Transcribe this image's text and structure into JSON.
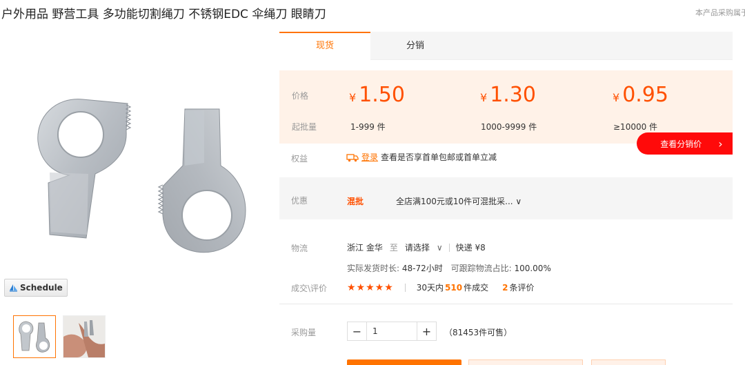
{
  "product": {
    "title": "户外用品 野营工具 多功能切割绳刀 不锈钢EDC 伞绳刀 眼睛刀",
    "top_note": "本产品采购属于",
    "main_image": "stainless steel eye-shaped rope cutter tools",
    "thumb_1": "two rope cutter tools",
    "thumb_2": "rope cutter held in fingers",
    "schedule_label": "Schedule"
  },
  "tabs": [
    {
      "label": "现货"
    },
    {
      "label": "分销"
    }
  ],
  "pricing": {
    "price_label": "价格",
    "qty_label": "起批量",
    "currency": "¥",
    "tiers": [
      {
        "price": "1.50",
        "range": "1-999 件"
      },
      {
        "price": "1.30",
        "range": "1000-9999 件"
      },
      {
        "price": "0.95",
        "range": "≥10000 件"
      }
    ],
    "distribution_button": "查看分销价",
    "distribution_arrow": "›"
  },
  "rights": {
    "label": "权益",
    "login_link": "登录",
    "text": "查看是否享首单包邮或首单立减"
  },
  "promo": {
    "label": "优惠",
    "tag": "混批",
    "text": "全店满100元或10件可混批采... ∨"
  },
  "shipping": {
    "label": "物流",
    "from": "浙江 金华",
    "to_word": "至",
    "destination": "请选择",
    "dropdown": "∨",
    "express": "快递 ¥8",
    "ship_time_label": "实际发货时长:",
    "ship_time": "48-72小时",
    "track_label": "可跟踪物流占比:",
    "track_value": "100.00%"
  },
  "reviews": {
    "label": "成交\\评价",
    "stars": "★★★★★",
    "rating_stars": 5,
    "deals_prefix": "30天内",
    "deals_count": "510",
    "deals_suffix": "件成交",
    "review_count": "2",
    "review_suffix": "条评价"
  },
  "purchase": {
    "label": "采购量",
    "minus": "−",
    "plus": "+",
    "quantity": "1",
    "stock": "（81453件可售）"
  },
  "colors": {
    "accent": "#ff7300",
    "price": "#ff5000",
    "distribution": "#ff0a0a",
    "price_bg": "#fff2e8"
  }
}
